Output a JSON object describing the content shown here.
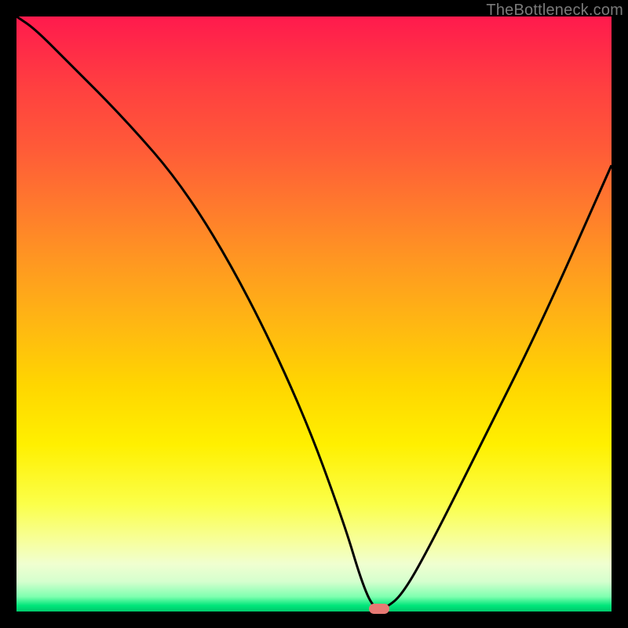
{
  "watermark": "TheBottleneck.com",
  "chart_data": {
    "type": "line",
    "title": "",
    "xlabel": "",
    "ylabel": "",
    "xlim": [
      0,
      100
    ],
    "ylim": [
      0,
      100
    ],
    "x": [
      0,
      3,
      8,
      18,
      28,
      38,
      48,
      55,
      58,
      60,
      62,
      65,
      70,
      78,
      88,
      100
    ],
    "values": [
      100,
      98,
      93,
      83,
      71.5,
      55,
      34,
      15,
      5,
      0.5,
      0.5,
      3,
      12,
      28,
      48,
      75
    ],
    "marker": {
      "x": 61,
      "y": 0.5
    },
    "gradient_colors": {
      "top": "#ff1a4d",
      "mid_high": "#ff9a20",
      "mid": "#fff000",
      "low": "#f0ffd0",
      "bottom": "#00c96b"
    }
  }
}
